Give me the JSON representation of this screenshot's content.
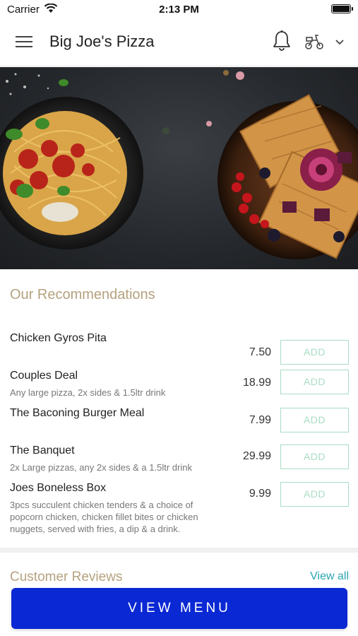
{
  "status_bar": {
    "carrier": "Carrier",
    "time": "2:13 PM"
  },
  "header": {
    "title": "Big Joe's Pizza",
    "icons": [
      "menu-icon",
      "bell-icon",
      "scooter-icon",
      "chevron-down-icon"
    ]
  },
  "hero": {
    "description_icons": [
      "spaghetti-plate",
      "waffle-plate"
    ]
  },
  "recommendations": {
    "title": "Our Recommendations",
    "add_label": "ADD",
    "items": [
      {
        "name": "Chicken Gyros Pita",
        "description": "",
        "price": "7.50"
      },
      {
        "name": "Couples Deal",
        "description": "Any large pizza, 2x sides & 1.5ltr drink",
        "price": "18.99"
      },
      {
        "name": "The Baconing Burger Meal",
        "description": "",
        "price": "7.99"
      },
      {
        "name": "The Banquet",
        "description": "2x Large pizzas, any 2x sides & a 1.5ltr drink",
        "price": "29.99"
      },
      {
        "name": "Joes Boneless Box",
        "description": "3pcs succulent chicken tenders & a choice of popcorn chicken, chicken fillet bites or chicken nuggets, served with fries, a dip & a drink.",
        "price": "9.99"
      }
    ]
  },
  "reviews": {
    "title": "Customer Reviews",
    "view_all": "View all"
  },
  "footer": {
    "view_menu": "VIEW MENU"
  },
  "colors": {
    "accent_gold": "#b5a27f",
    "add_green": "#a9dcc4",
    "link_teal": "#2aa5b0",
    "primary_blue": "#0a28d3"
  }
}
